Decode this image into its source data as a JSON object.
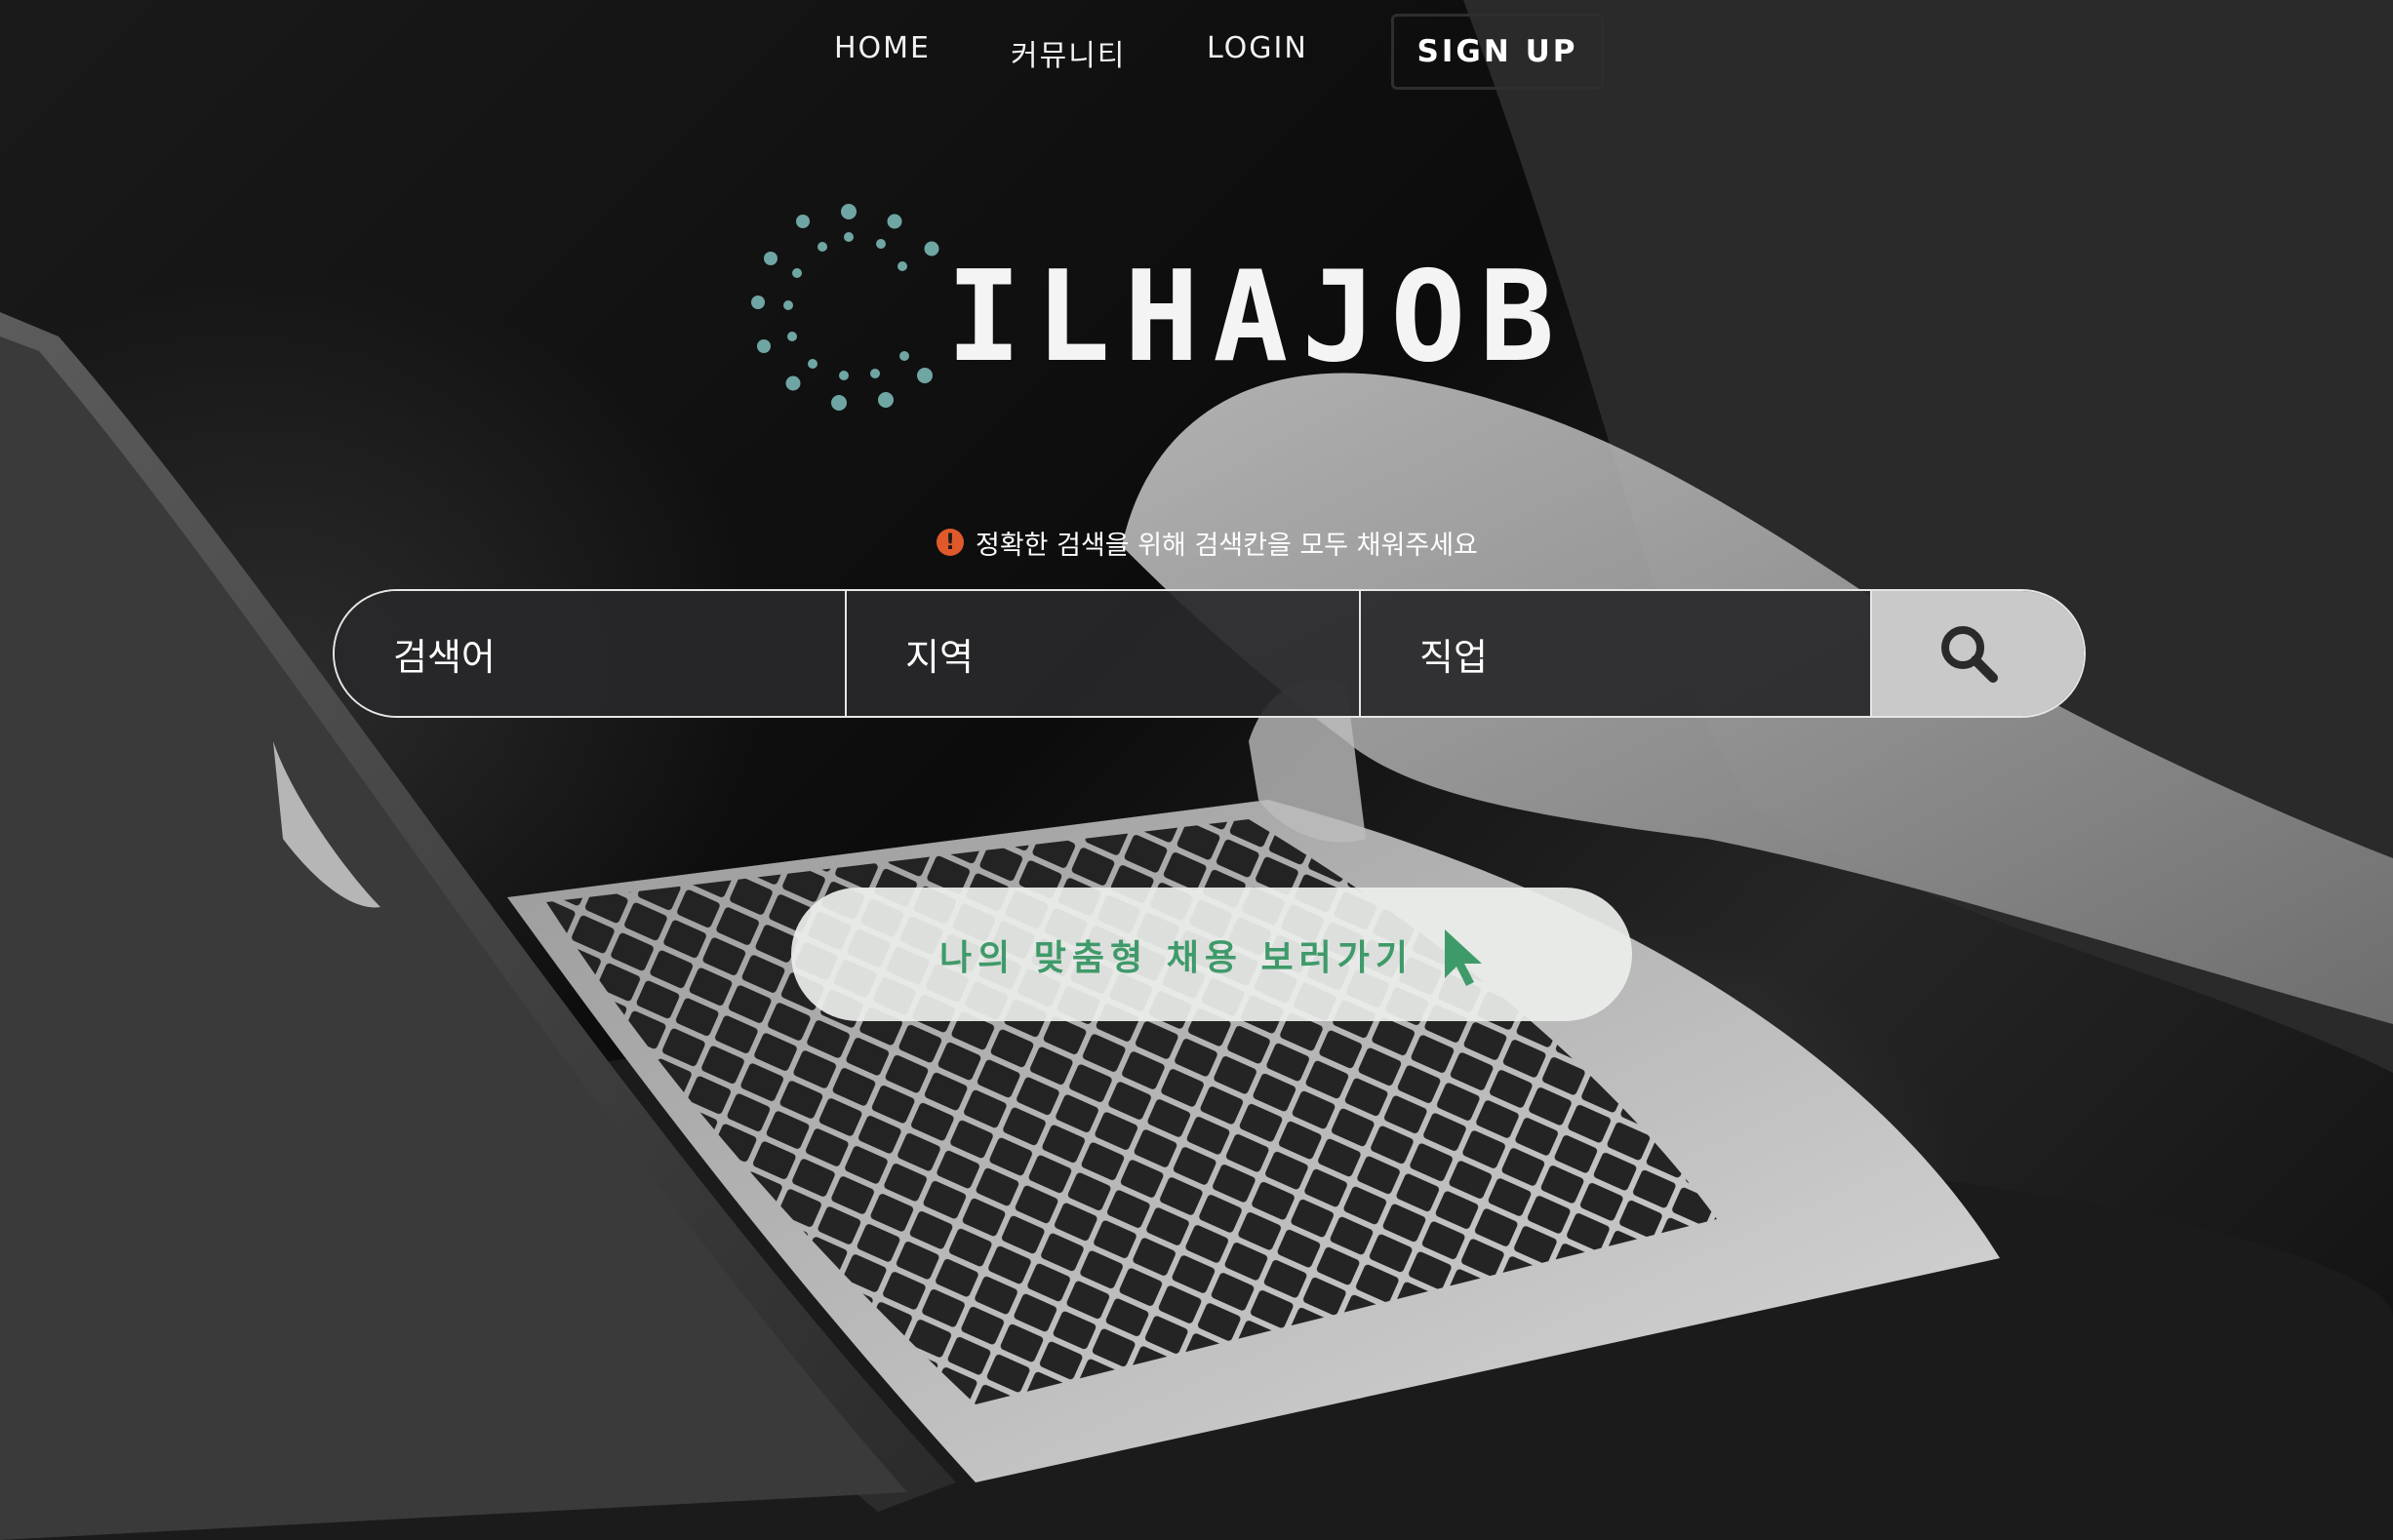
{
  "nav": {
    "home": "HOME",
    "community": "커뮤니티",
    "login": "LOGIN",
    "signup": "SIGN UP"
  },
  "logo": {
    "text": "ILHAJOB",
    "dot_color": "#6fa6a4"
  },
  "notice": {
    "icon": "!",
    "text": "정확한 검색을 위해 검색칸을 모두 채워주세요"
  },
  "search": {
    "keyword_placeholder": "검색어",
    "region_placeholder": "지역",
    "job_placeholder": "직업",
    "button_icon": "search-icon"
  },
  "cta": {
    "label": "나의 맞춤형 채용 보러가기",
    "icon": "cursor-arrow-icon",
    "accent": "#3f9a6a"
  },
  "colors": {
    "notice_icon": "#e0592a",
    "search_button_bg": "#c9c9c9"
  }
}
